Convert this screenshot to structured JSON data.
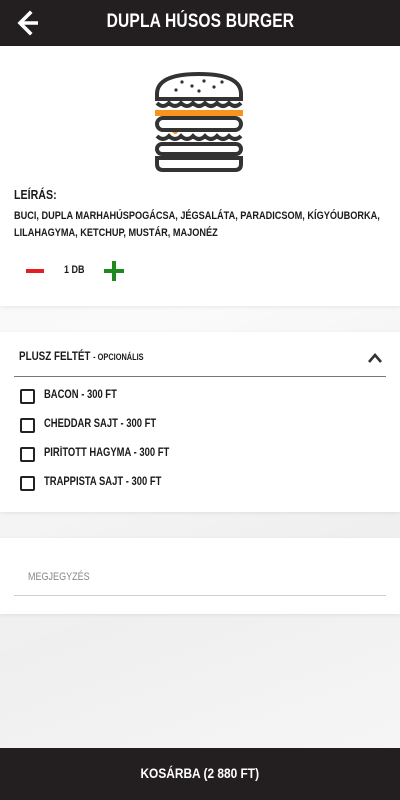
{
  "header": {
    "title": "DUPLA HÚSOS BURGER",
    "back_icon": "arrow-left-icon"
  },
  "product": {
    "image_icon": "double-burger-icon",
    "description_label": "LEÍRÁS:",
    "description": "BUCI, DUPLA MARHAHÚSPOGÁCSA, JÉGSALÁTA, PARADICSOM, KÍGYÓUBORKA, LILAHAGYMA, KETCHUP, MUSTÁR, MAJONÉZ",
    "quantity": "1 DB",
    "minus_icon": "minus-icon",
    "plus_icon": "plus-icon"
  },
  "extras": {
    "title": "PLUSZ FELTÉT",
    "subtitle": "- OPCIONÁLIS",
    "options": [
      {
        "label": "BACON - 300 FT",
        "checked": false
      },
      {
        "label": "CHEDDAR SAJT - 300 FT",
        "checked": false
      },
      {
        "label": "PIRÍTOTT HAGYMA - 300 FT",
        "checked": false
      },
      {
        "label": "TRAPPISTA SAJT - 300 FT",
        "checked": false
      }
    ]
  },
  "note": {
    "placeholder": "MEGJEGYZÉS",
    "value": ""
  },
  "footer": {
    "button_label": "KOSÁRBA (2 880 FT)"
  },
  "colors": {
    "dark": "#231f20",
    "minus": "#e31e24",
    "plus": "#1e8a1e",
    "cheese": "#f7941d"
  }
}
